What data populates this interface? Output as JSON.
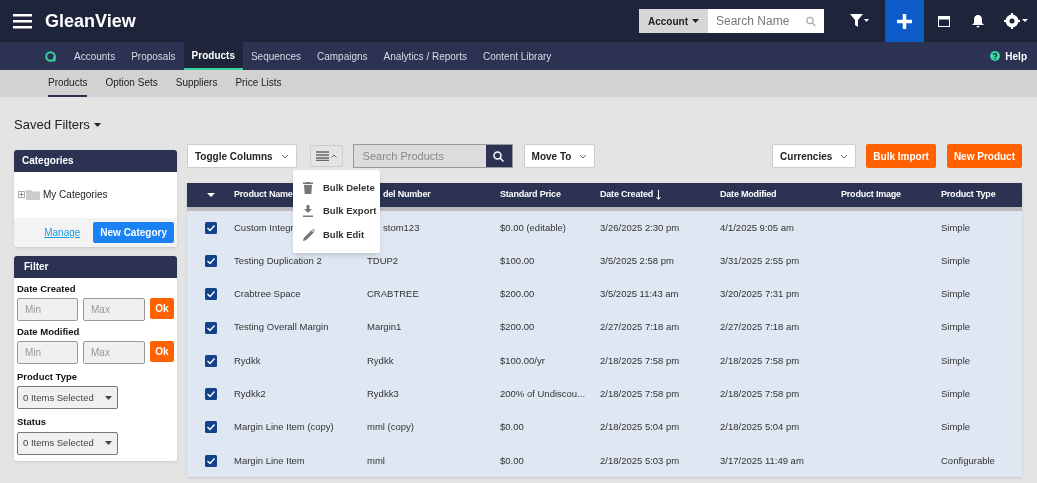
{
  "app": {
    "title": "GleanView"
  },
  "search": {
    "scope": "Account",
    "placeholder": "Search Name"
  },
  "nav": [
    {
      "label": "Accounts",
      "selected": false
    },
    {
      "label": "Proposals",
      "selected": false
    },
    {
      "label": "Products",
      "selected": true
    },
    {
      "label": "Sequences",
      "selected": false
    },
    {
      "label": "Campaigns",
      "selected": false
    },
    {
      "label": "Analytics / Reports",
      "selected": false
    },
    {
      "label": "Content Library",
      "selected": false
    }
  ],
  "help": "Help",
  "subnav": [
    {
      "label": "Products",
      "selected": true
    },
    {
      "label": "Option Sets",
      "selected": false
    },
    {
      "label": "Suppliers",
      "selected": false
    },
    {
      "label": "Price Lists",
      "selected": false
    }
  ],
  "saved_filters": "Saved Filters",
  "categories": {
    "title": "Categories",
    "tree": [
      {
        "label": "My Categories",
        "expanded": false
      }
    ],
    "manage": "Manage",
    "new_button": "New Category"
  },
  "filter": {
    "title": "Filter",
    "date_fields": [
      {
        "label": "Date Created",
        "min": {
          "placeholder": "Min"
        },
        "max": {
          "placeholder": "Max"
        },
        "button": "Ok"
      },
      {
        "label": "Date Modified",
        "min": {
          "placeholder": "Min"
        },
        "max": {
          "placeholder": "Max"
        },
        "button": "Ok"
      }
    ],
    "selects": [
      {
        "label": "Product Type",
        "value": "0 Items Selected"
      },
      {
        "label": "Status",
        "value": "0 Items Selected"
      }
    ]
  },
  "toolbar": {
    "toggle_columns": "Toggle Columns",
    "search_placeholder": "Search Products",
    "move_to": "Move To",
    "currencies": "Currencies",
    "bulk_import": "Bulk Import",
    "new_product": "New Product"
  },
  "bulk_menu": [
    {
      "kind": "delete",
      "label": "Bulk Delete"
    },
    {
      "kind": "export",
      "label": "Bulk Export"
    },
    {
      "kind": "edit",
      "label": "Bulk Edit"
    }
  ],
  "table": {
    "columns": [
      {
        "label": "Product Name"
      },
      {
        "label": "del Number",
        "sorted": false
      },
      {
        "label": "Standard Price",
        "sorted": false
      },
      {
        "label": "Date Created",
        "sorted": true
      },
      {
        "label": "Date Modified",
        "sorted": false
      },
      {
        "label": "Product Image",
        "sorted": false
      },
      {
        "label": "Product Type",
        "sorted": false
      }
    ],
    "rows": [
      {
        "checked": true,
        "cells": [
          "Custom Integr",
          "stom123",
          "$0.00 (editable)",
          "3/26/2025 2:30 pm",
          "4/1/2025 9:05 am",
          "",
          "Simple"
        ]
      },
      {
        "checked": true,
        "cells": [
          "Testing Duplication 2",
          "TDUP2",
          "$100.00",
          "3/5/2025 2:58 pm",
          "3/31/2025 2:55 pm",
          "",
          "Simple"
        ]
      },
      {
        "checked": true,
        "cells": [
          "Crabtree Space",
          "CRABTREE",
          "$200.00",
          "3/5/2025 11:43 am",
          "3/20/2025 7:31 pm",
          "",
          "Simple"
        ]
      },
      {
        "checked": true,
        "cells": [
          "Testing Overall Margin",
          "Margin1",
          "$200.00",
          "2/27/2025 7:18 am",
          "2/27/2025 7:18 am",
          "",
          "Simple"
        ]
      },
      {
        "checked": true,
        "cells": [
          "Rydkk",
          "Rydkk",
          "$100.00/yr",
          "2/18/2025 7:58 pm",
          "2/18/2025 7:58 pm",
          "",
          "Simple"
        ]
      },
      {
        "checked": true,
        "cells": [
          "Rydkk2",
          "Rydkk3",
          "200% of Undiscou...",
          "2/18/2025 7:58 pm",
          "2/18/2025 7:58 pm",
          "",
          "Simple"
        ]
      },
      {
        "checked": true,
        "cells": [
          "Margin Line Item (copy)",
          "mml (copy)",
          "$0.00",
          "2/18/2025 5:04 pm",
          "2/18/2025 5:04 pm",
          "",
          "Simple"
        ]
      },
      {
        "checked": true,
        "cells": [
          "Margin Line Item",
          "mml",
          "$0.00",
          "2/18/2025 5:03 pm",
          "3/17/2025 11:49 am",
          "",
          "Configurable"
        ]
      }
    ]
  }
}
